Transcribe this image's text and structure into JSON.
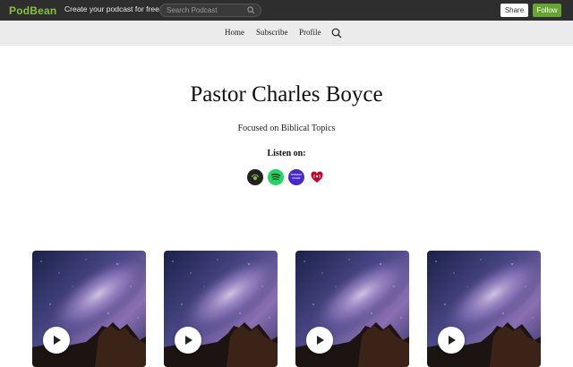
{
  "topbar": {
    "logo_text": "PodBean",
    "promo": "Create your podcast for free",
    "search_placeholder": "Search Podcast",
    "share_label": "Share",
    "follow_label": "Follow"
  },
  "nav": {
    "items": [
      {
        "label": "Home"
      },
      {
        "label": "Subscribe"
      },
      {
        "label": "Profile"
      }
    ]
  },
  "header": {
    "title": "Pastor Charles Boyce",
    "subtitle": "Focused on Biblical Topics",
    "listen_on": "Listen on:"
  },
  "platforms": [
    {
      "name": "podbean",
      "icon": "podbean-icon"
    },
    {
      "name": "spotify",
      "icon": "spotify-icon"
    },
    {
      "name": "amazon-music",
      "icon": "amazon-music-icon",
      "text_top": "amazon",
      "text_bottom": "music"
    },
    {
      "name": "iheartradio",
      "icon": "iheartradio-icon"
    }
  ],
  "episodes": [
    {
      "image": "milky-way-night-sky"
    },
    {
      "image": "milky-way-night-sky"
    },
    {
      "image": "milky-way-night-sky"
    },
    {
      "image": "milky-way-night-sky"
    }
  ],
  "colors": {
    "topbar_bg": "#2e2e2e",
    "brand_green": "#86c33b",
    "follow_bg": "#64a62f",
    "navbar_bg": "#ebebeb"
  }
}
